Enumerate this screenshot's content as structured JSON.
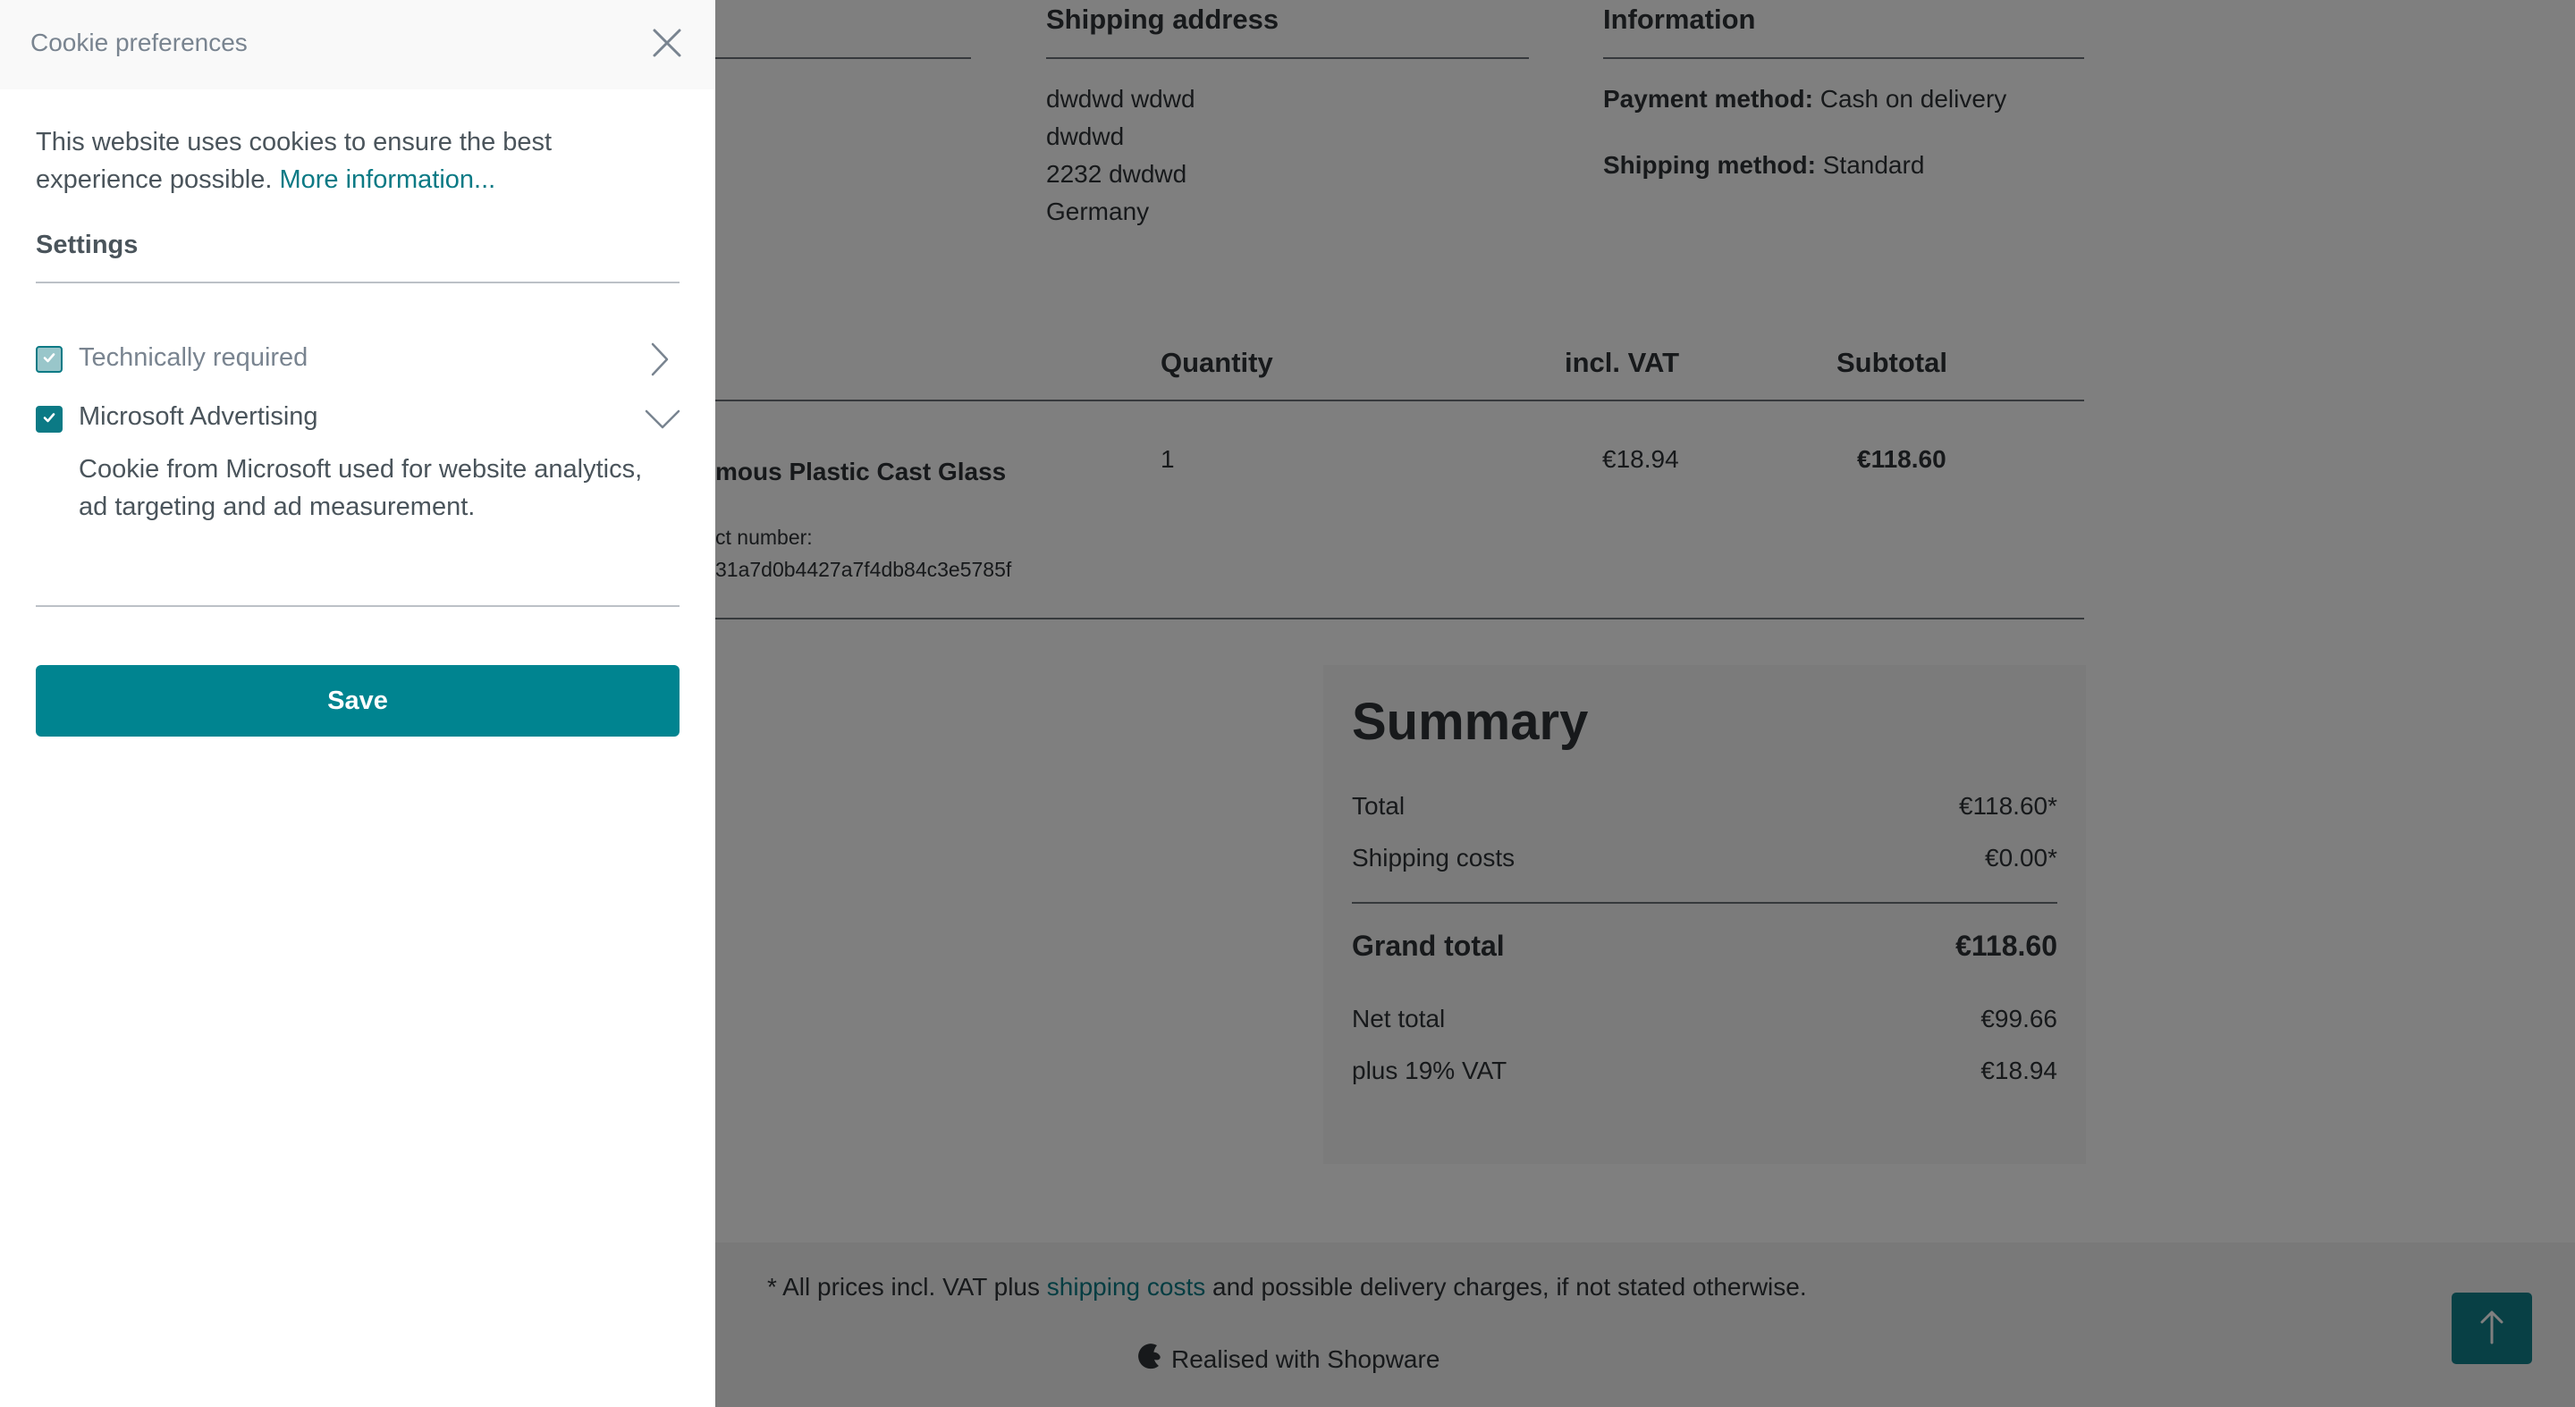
{
  "cookie_panel": {
    "title": "Cookie preferences",
    "intro_text": "This website uses cookies to ensure the best experience possible.",
    "more_info_link": "More information...",
    "settings_heading": "Settings",
    "groups": [
      {
        "label": "Technically required",
        "checked": true,
        "disabled": true,
        "expanded": false
      },
      {
        "label": "Microsoft Advertising",
        "checked": true,
        "disabled": false,
        "expanded": true,
        "description": "Cookie from Microsoft used for website analytics, ad targeting and ad measurement."
      }
    ],
    "save_label": "Save"
  },
  "order": {
    "shipping_address": {
      "heading": "Shipping address",
      "lines": [
        "dwdwd wdwd",
        "dwdwd",
        "2232 dwdwd",
        "Germany"
      ]
    },
    "information": {
      "heading": "Information",
      "payment_label": "Payment method:",
      "payment_value": "Cash on delivery",
      "shipping_label": "Shipping method:",
      "shipping_value": "Standard"
    },
    "table": {
      "columns": [
        "Quantity",
        "incl. VAT",
        "Subtotal"
      ],
      "rows": [
        {
          "product_name_visible": "mous Plastic Cast Glass",
          "product_number_label_visible": "ct number:",
          "product_number_visible": "31a7d0b4427a7f4db84c3e5785f",
          "quantity": "1",
          "vat": "€18.94",
          "subtotal": "€118.60"
        }
      ]
    },
    "summary": {
      "heading": "Summary",
      "total_label": "Total",
      "total_value": "€118.60*",
      "shipping_label": "Shipping costs",
      "shipping_value": "€0.00*",
      "grand_total_label": "Grand total",
      "grand_total_value": "€118.60",
      "net_label": "Net total",
      "net_value": "€99.66",
      "vat_label": "plus 19% VAT",
      "vat_value": "€18.94"
    }
  },
  "footer": {
    "notice_prefix": "* All prices incl. VAT plus",
    "notice_link": "shipping costs",
    "notice_suffix": "and possible delivery charges, if not stated otherwise.",
    "realised_with": "Realised with Shopware"
  },
  "colors": {
    "accent": "#008490",
    "link": "#0b7a85",
    "text": "#4a545b",
    "overlay": "rgba(0,0,0,0.5)"
  },
  "icons": {
    "close": "close-icon",
    "chevron_right": "chevron-right-icon",
    "chevron_down": "chevron-down-icon",
    "checkmark": "checkmark-icon",
    "arrow_up": "arrow-up-icon",
    "shopware_logo": "shopware-logo-icon"
  }
}
